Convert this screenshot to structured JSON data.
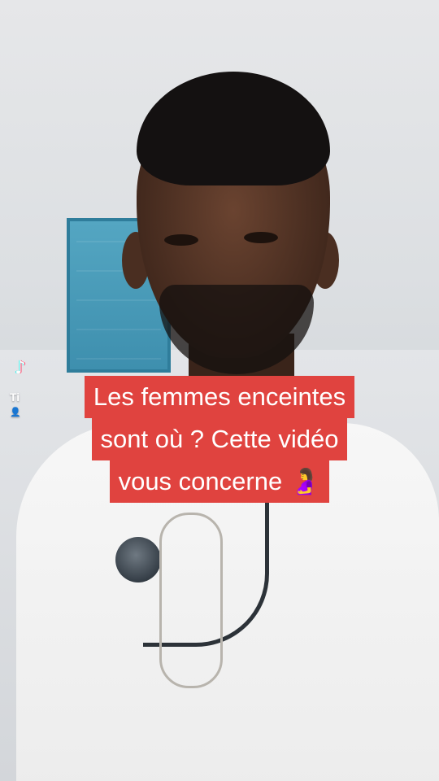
{
  "watermark": {
    "logo_icon": "tiktok-note-icon",
    "name": "Ti",
    "user_icon": "user-icon",
    "user_glyph": "👤"
  },
  "caption": {
    "lines": [
      "Les femmes enceintes",
      "sont où ? Cette vidéo",
      "vous concerne 🤰"
    ],
    "background_color": "#e0433f",
    "text_color": "#ffffff"
  }
}
